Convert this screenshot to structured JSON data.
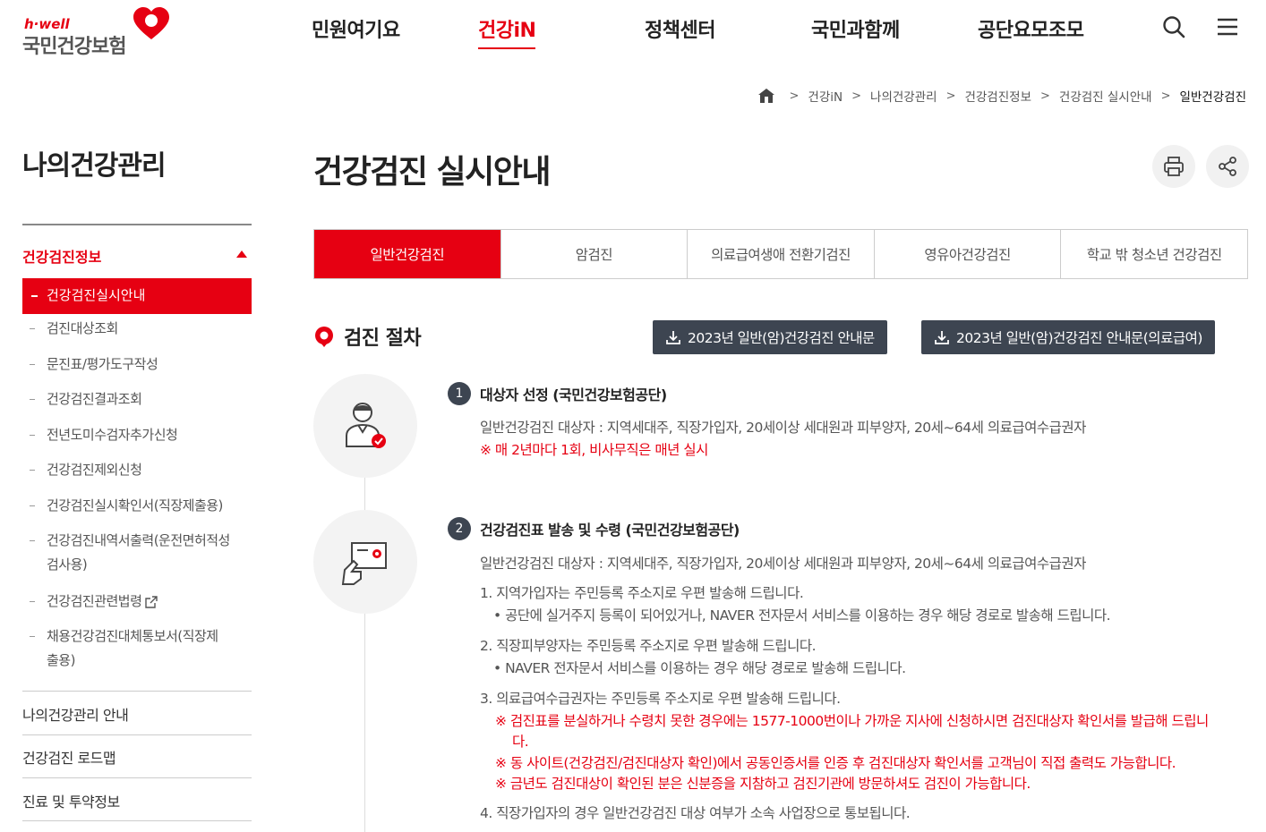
{
  "logo": {
    "eng": "h·well",
    "kor": "국민건강보험"
  },
  "gnb": [
    "민원여기요",
    "건강iN",
    "정책센터",
    "국민과함께",
    "공단요모조모"
  ],
  "breadcrumb": [
    "건강iN",
    "나의건강관리",
    "건강검진정보",
    "건강검진 실시안내",
    "일반건강검진"
  ],
  "sidebar": {
    "title": "나의건강관리",
    "section": "건강검진정보",
    "active": "건강검진실시안내",
    "subitems": [
      "검진대상조회",
      "문진표/평가도구작성",
      "건강검진결과조회",
      "전년도미수검자추가신청",
      "건강검진제외신청",
      "건강검진실시확인서(직장제출용)",
      "건강검진내역서출력(운전면허적성",
      "검사용)",
      "건강검진관련법령",
      "채용건강검진대체통보서(직장제",
      "출용)"
    ],
    "main_items": [
      "나의건강관리 안내",
      "건강검진 로드맵",
      "진료 및 투약정보"
    ]
  },
  "page": {
    "title": "건강검진 실시안내"
  },
  "tabs": [
    "일반건강검진",
    "암검진",
    "의료급여생애 전환기검진",
    "영유아건강검진",
    "학교 밖 청소년 건강검진"
  ],
  "section": {
    "title": "검진 절차",
    "download1": "2023년 일반(암)건강검진 안내문",
    "download2": "2023년 일반(암)건강검진 안내문(의료급여)"
  },
  "steps": [
    {
      "num": "1",
      "title": "대상자 선정 (국민건강보험공단)",
      "desc": "일반건강검진 대상자 : 지역세대주, 직장가입자, 20세이상 세대원과 피부양자, 20세~64세 의료급여수급권자",
      "note": "※ 매 2년마다 1회, 비사무직은 매년 실시"
    },
    {
      "num": "2",
      "title": "건강검진표 발송 및 수령 (국민건강보험공단)",
      "desc": "일반건강검진 대상자 : 지역세대주, 직장가입자, 20세이상 세대원과 피부양자, 20세~64세 의료급여수급권자",
      "l1": "1. 지역가입자는 주민등록 주소지로 우편 발송해 드립니다.",
      "l1b": "• 공단에 실거주지 등록이 되어있거나, NAVER 전자문서 서비스를 이용하는 경우 해당 경로로 발송해 드립니다.",
      "l2": "2. 직장피부양자는 주민등록 주소지로 우편 발송해 드립니다.",
      "l2b": "• NAVER 전자문서 서비스를 이용하는 경우 해당 경로로 발송해 드립니다.",
      "l3": "3. 의료급여수급권자는 주민등록 주소지로 우편 발송해 드립니다.",
      "l3a": "※ 검진표를 분실하거나 수령치 못한 경우에는 1577-1000번이나 가까운 지사에 신청하시면 검진대상자 확인서를 발급해 드립니",
      "l3a2": "다.",
      "l3b": "※ 동 사이트(건강검진/검진대상자 확인)에서 공동인증서를 인증 후 검진대상자 확인서를 고객님이 직접 출력도 가능합니다.",
      "l3c": "※ 금년도 검진대상이 확인된 분은 신분증을 지참하고 검진기관에 방문하셔도 검진이 가능합니다.",
      "l4": "4. 직장가입자의 경우 일반건강검진 대상 여부가 소속 사업장으로 통보됩니다."
    }
  ],
  "colors": {
    "accent": "#e60012",
    "dark": "#3d4551"
  },
  "icons": [
    "heart-logo-icon",
    "search-icon",
    "menu-icon",
    "home-icon",
    "print-icon",
    "share-icon",
    "pin-icon",
    "download-icon",
    "external-link-icon",
    "doctor-icon",
    "card-hand-icon"
  ]
}
